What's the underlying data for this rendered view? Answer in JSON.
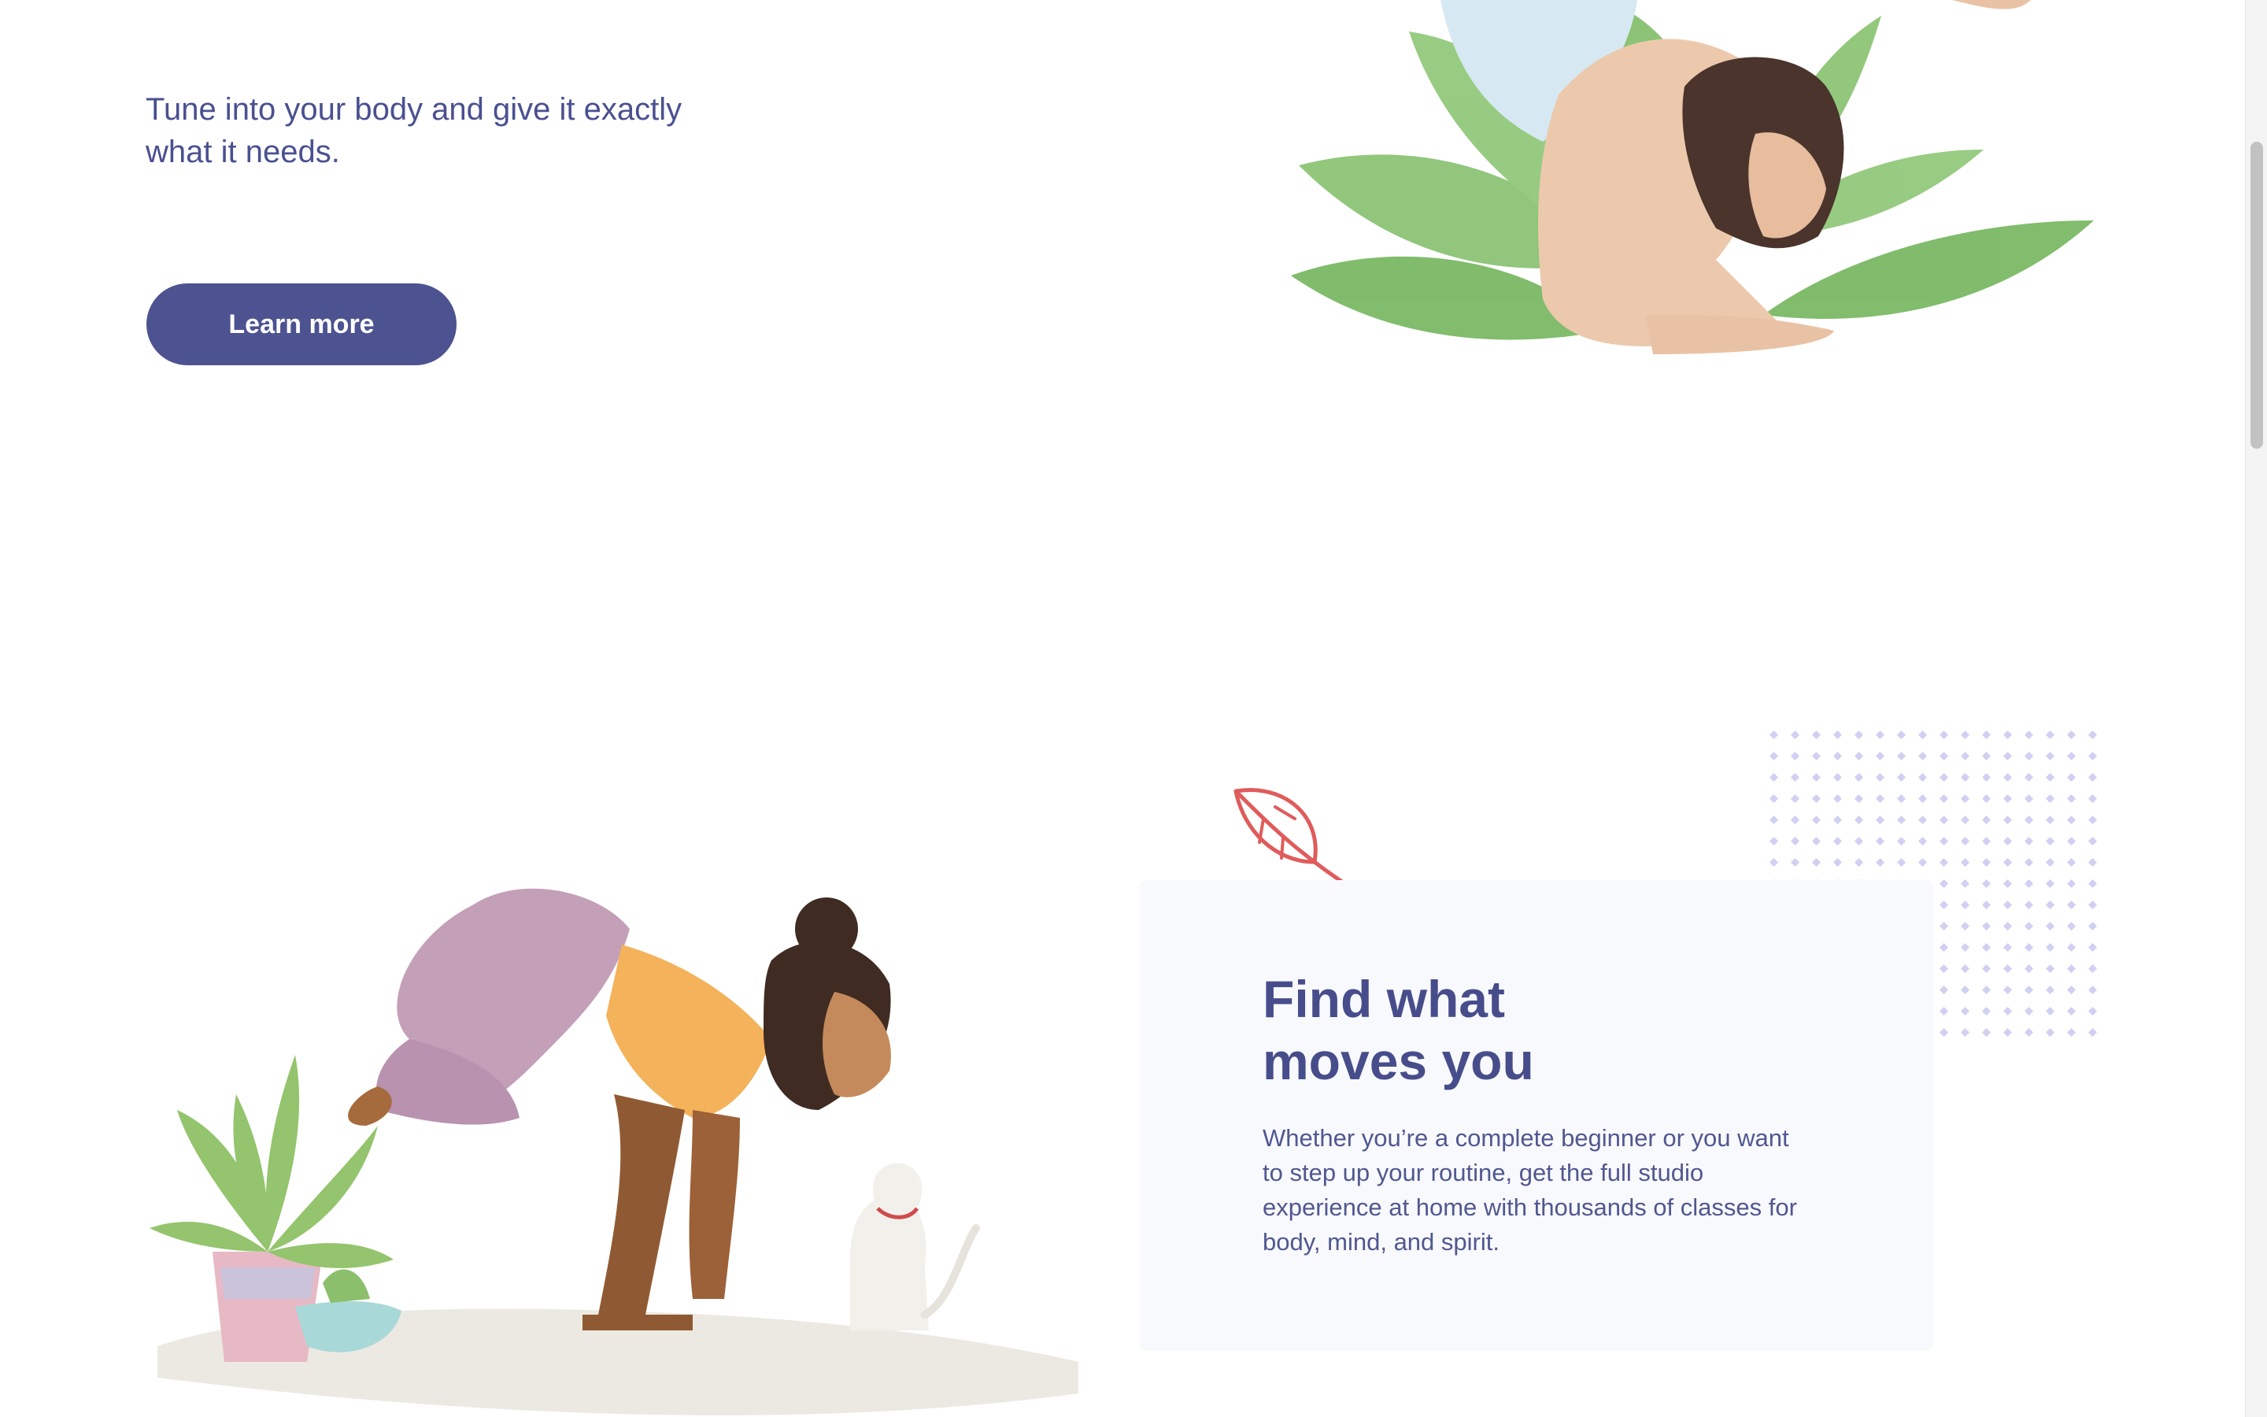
{
  "hero": {
    "intro": "Tune into your body and give it exactly what it needs.",
    "button_label": "Learn more"
  },
  "feature": {
    "title_line1": "Find what",
    "title_line2": "moves you",
    "body": "Whether you’re a complete beginner or you want to step up your routine, get the full studio experience at home with thousands of classes for body, mind, and spirit."
  },
  "colors": {
    "brand": "#4d5290",
    "heading": "#474d8b",
    "card_bg": "#f8f9fc",
    "dots": "#cfd0f2",
    "leaf_outline": "#e05b5b"
  },
  "icons": {
    "leaf": "leaf-icon",
    "dots": "dot-pattern"
  }
}
